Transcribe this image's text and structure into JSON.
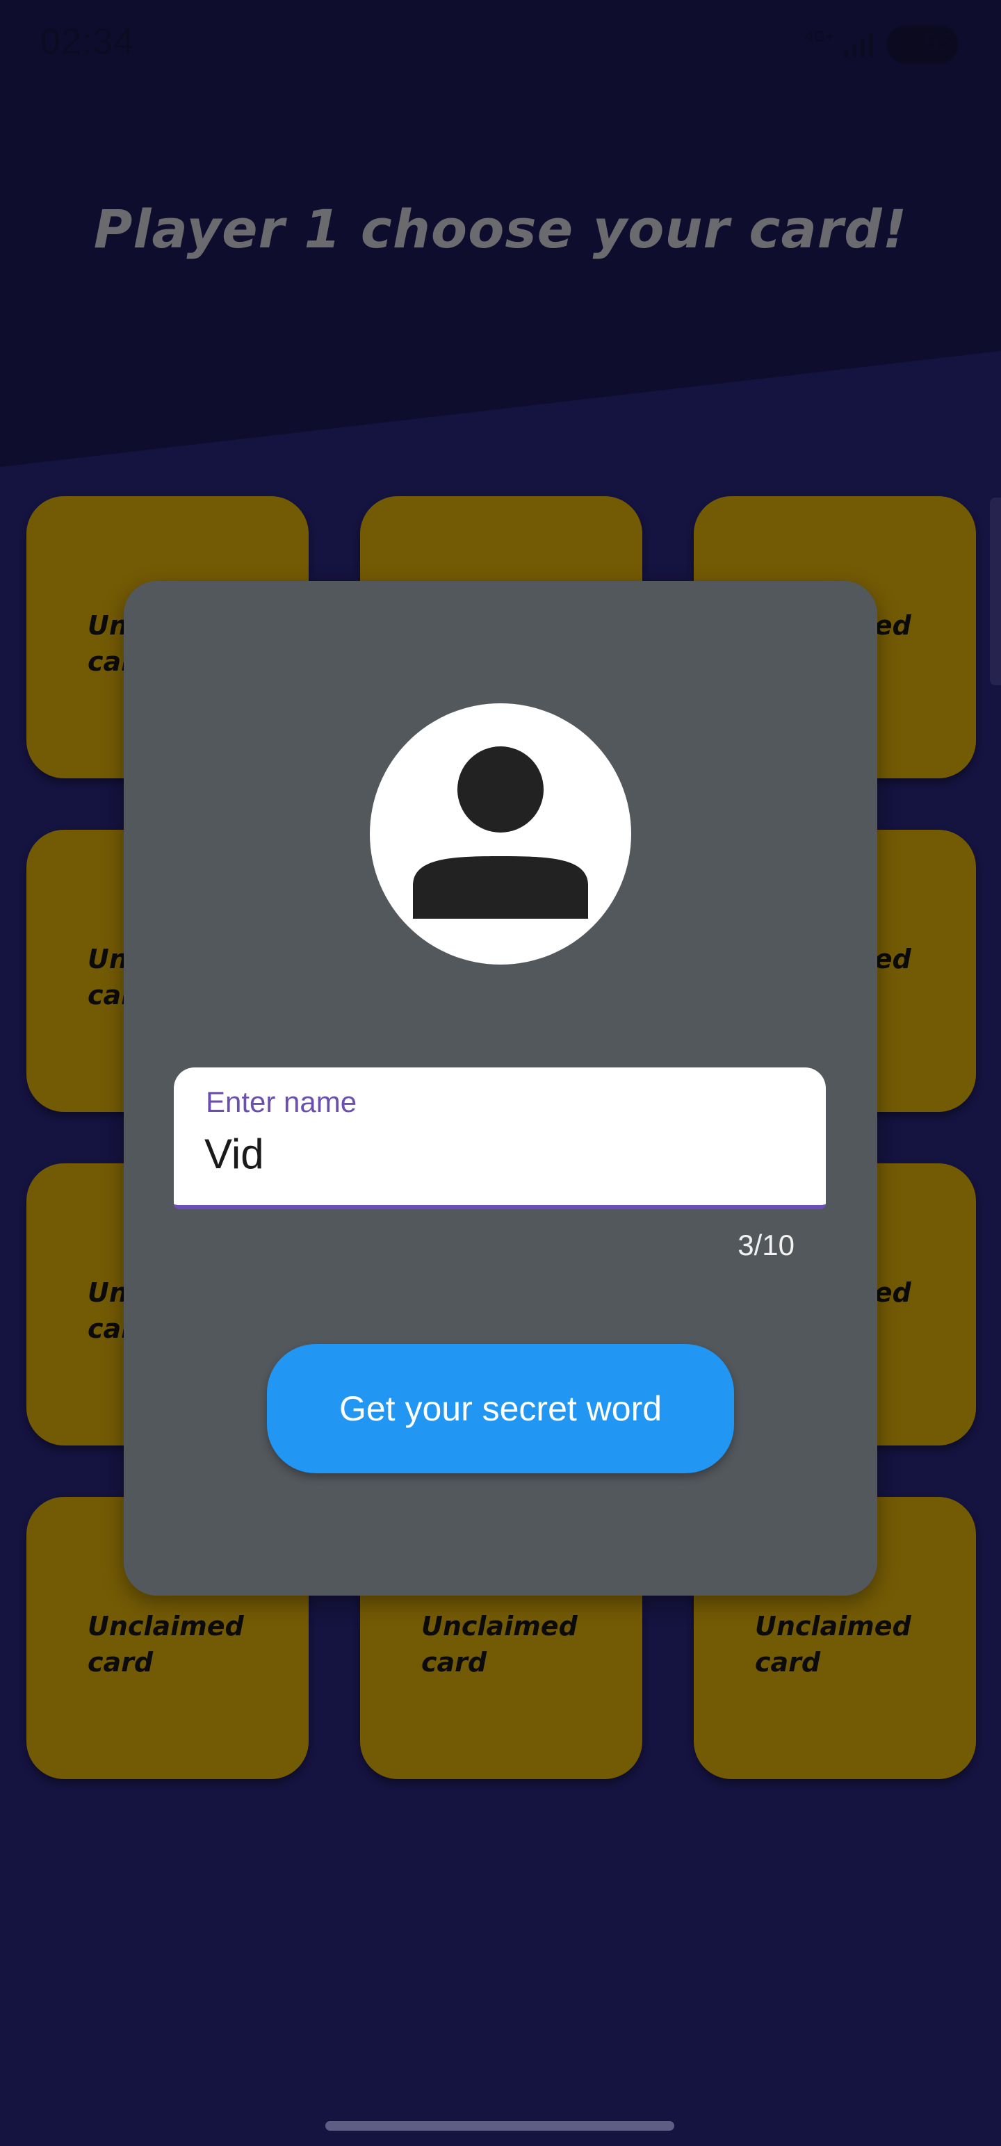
{
  "status_bar": {
    "time": "02:34",
    "network": "4G+",
    "battery": "55"
  },
  "title": "Player 1 choose your card!",
  "cards": [
    {
      "label": "Unclaimed card"
    },
    {
      "label": "Unclaimed card"
    },
    {
      "label": "Unclaimed card"
    },
    {
      "label": "Unclaimed card"
    },
    {
      "label": "Unclaimed card"
    },
    {
      "label": "Unclaimed card"
    },
    {
      "label": "Unclaimed card"
    },
    {
      "label": "Unclaimed card"
    },
    {
      "label": "Unclaimed card"
    },
    {
      "label": "Unclaimed card"
    },
    {
      "label": "Unclaimed card"
    },
    {
      "label": "Unclaimed card"
    }
  ],
  "dialog": {
    "avatar_icon": "person-icon",
    "name_field": {
      "label": "Enter name",
      "value": "Vid"
    },
    "char_counter": "3/10",
    "submit_label": "Get your secret word"
  },
  "colors": {
    "background": "#15133f",
    "card": "#735a05",
    "dialog": "#53585d",
    "button": "#2196f3",
    "field_accent": "#6b4fbb"
  }
}
